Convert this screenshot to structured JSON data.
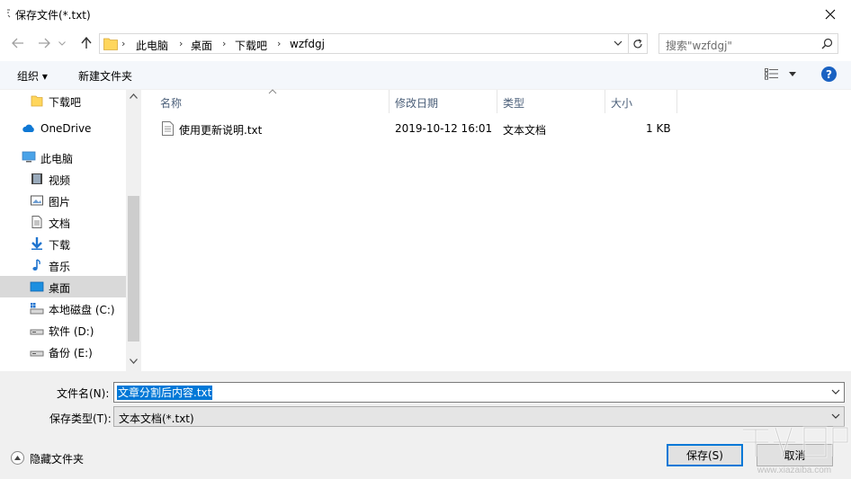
{
  "window": {
    "title": "保存文件(*.txt)"
  },
  "address": {
    "crumbs": [
      "此电脑",
      "桌面",
      "下载吧",
      "wzfdgj"
    ]
  },
  "search": {
    "placeholder": "搜索\"wzfdgj\""
  },
  "toolbar": {
    "organize": "组织 ▾",
    "new_folder": "新建文件夹",
    "help": "?"
  },
  "sidebar": {
    "items": [
      {
        "label": "下载吧",
        "icon": "folder-icon"
      },
      {
        "label": "OneDrive",
        "icon": "cloud-icon"
      },
      {
        "label": "此电脑",
        "icon": "computer-icon"
      },
      {
        "label": "视频",
        "icon": "video-icon"
      },
      {
        "label": "图片",
        "icon": "pictures-icon"
      },
      {
        "label": "文档",
        "icon": "documents-icon"
      },
      {
        "label": "下载",
        "icon": "download-icon"
      },
      {
        "label": "音乐",
        "icon": "music-icon"
      },
      {
        "label": "桌面",
        "icon": "desktop-icon",
        "selected": true
      },
      {
        "label": "本地磁盘 (C:)",
        "icon": "system-drive-icon"
      },
      {
        "label": "软件 (D:)",
        "icon": "drive-icon"
      },
      {
        "label": "备份 (E:)",
        "icon": "drive-icon"
      }
    ]
  },
  "filelist": {
    "columns": [
      "名称",
      "修改日期",
      "类型",
      "大小"
    ],
    "rows": [
      {
        "name": "使用更新说明.txt",
        "modified": "2019-10-12 16:01",
        "type": "文本文档",
        "size": "1 KB"
      }
    ]
  },
  "form": {
    "filename_label": "文件名(N):",
    "filename_value": "文章分割后内容.txt",
    "filetype_label": "保存类型(T):",
    "filetype_value": "文本文档(*.txt)",
    "hide_folders": "隐藏文件夹",
    "save": "保存(S)",
    "cancel": "取消"
  },
  "watermark": {
    "text": "www.xiazaiba.com"
  },
  "colors": {
    "accent": "#0078d7",
    "help": "#1a62c2",
    "toolbar_bg": "#f4f7fb",
    "bottom_bg": "#f0f0f0"
  }
}
